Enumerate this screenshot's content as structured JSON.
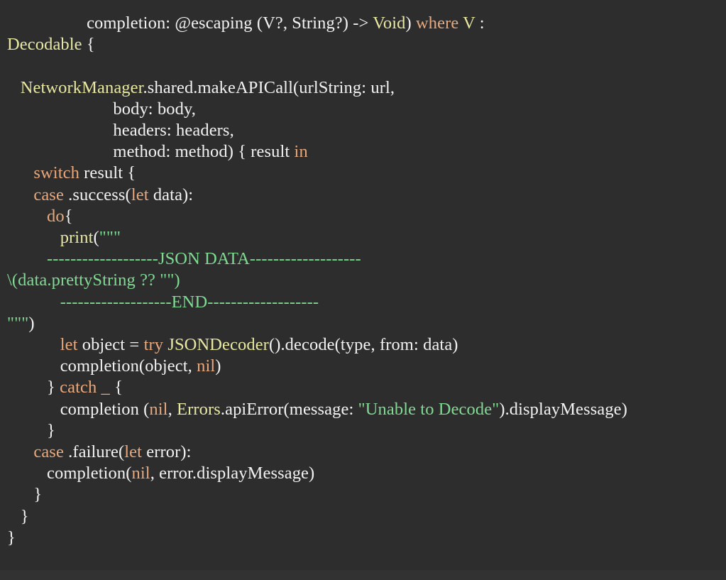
{
  "editor": {
    "language": "swift",
    "background_color": "#2d2d2d",
    "colors": {
      "plain": "#f2f2f2",
      "keyword": "#e8a87c",
      "type": "#e8e8a2",
      "string": "#7fdb92"
    }
  },
  "code": {
    "lines": [
      {
        "id": "line-1",
        "tokens": [
          {
            "text": "                  completion: @escaping (V?, String?) -> ",
            "kind": "plain"
          },
          {
            "text": "Void",
            "kind": "type"
          },
          {
            "text": ") ",
            "kind": "plain"
          },
          {
            "text": "where",
            "kind": "keyword"
          },
          {
            "text": " ",
            "kind": "plain"
          },
          {
            "text": "V",
            "kind": "type"
          },
          {
            "text": " :",
            "kind": "plain"
          }
        ]
      },
      {
        "id": "line-2",
        "tokens": [
          {
            "text": "Decodable",
            "kind": "type"
          },
          {
            "text": " {",
            "kind": "plain"
          }
        ]
      },
      {
        "id": "line-3",
        "tokens": [
          {
            "text": "",
            "kind": "plain"
          }
        ]
      },
      {
        "id": "line-4",
        "tokens": [
          {
            "text": "   ",
            "kind": "plain"
          },
          {
            "text": "NetworkManager",
            "kind": "type"
          },
          {
            "text": ".shared.makeAPICall(urlString: url,",
            "kind": "plain"
          }
        ]
      },
      {
        "id": "line-5",
        "tokens": [
          {
            "text": "                        body: body,",
            "kind": "plain"
          }
        ]
      },
      {
        "id": "line-6",
        "tokens": [
          {
            "text": "                        headers: headers,",
            "kind": "plain"
          }
        ]
      },
      {
        "id": "line-7",
        "tokens": [
          {
            "text": "                        method: method) { result ",
            "kind": "plain"
          },
          {
            "text": "in",
            "kind": "keyword"
          }
        ]
      },
      {
        "id": "line-8",
        "tokens": [
          {
            "text": "      ",
            "kind": "plain"
          },
          {
            "text": "switch",
            "kind": "keyword"
          },
          {
            "text": " result {",
            "kind": "plain"
          }
        ]
      },
      {
        "id": "line-9",
        "tokens": [
          {
            "text": "      ",
            "kind": "plain"
          },
          {
            "text": "case",
            "kind": "keyword"
          },
          {
            "text": " .success(",
            "kind": "plain"
          },
          {
            "text": "let",
            "kind": "keyword"
          },
          {
            "text": " data):",
            "kind": "plain"
          }
        ]
      },
      {
        "id": "line-10",
        "tokens": [
          {
            "text": "         ",
            "kind": "plain"
          },
          {
            "text": "do",
            "kind": "keyword"
          },
          {
            "text": "{",
            "kind": "plain"
          }
        ]
      },
      {
        "id": "line-11",
        "tokens": [
          {
            "text": "            ",
            "kind": "plain"
          },
          {
            "text": "print",
            "kind": "type"
          },
          {
            "text": "(",
            "kind": "plain"
          },
          {
            "text": "\"\"\"",
            "kind": "string"
          }
        ]
      },
      {
        "id": "line-12",
        "tokens": [
          {
            "text": "         -------------------JSON DATA-------------------",
            "kind": "string"
          }
        ]
      },
      {
        "id": "line-13",
        "tokens": [
          {
            "text": "\\(data.prettyString ?? \"\")",
            "kind": "string"
          }
        ]
      },
      {
        "id": "line-14",
        "tokens": [
          {
            "text": "            -------------------END-------------------",
            "kind": "string"
          }
        ]
      },
      {
        "id": "line-15",
        "tokens": [
          {
            "text": "\"\"\"",
            "kind": "string"
          },
          {
            "text": ")",
            "kind": "plain"
          }
        ]
      },
      {
        "id": "line-16",
        "tokens": [
          {
            "text": "            ",
            "kind": "plain"
          },
          {
            "text": "let",
            "kind": "keyword"
          },
          {
            "text": " object = ",
            "kind": "plain"
          },
          {
            "text": "try",
            "kind": "keyword"
          },
          {
            "text": " ",
            "kind": "plain"
          },
          {
            "text": "JSONDecoder",
            "kind": "type"
          },
          {
            "text": "().decode(type, from: data)",
            "kind": "plain"
          }
        ]
      },
      {
        "id": "line-17",
        "tokens": [
          {
            "text": "            completion(object, ",
            "kind": "plain"
          },
          {
            "text": "nil",
            "kind": "keyword"
          },
          {
            "text": ")",
            "kind": "plain"
          }
        ]
      },
      {
        "id": "line-18",
        "tokens": [
          {
            "text": "         } ",
            "kind": "plain"
          },
          {
            "text": "catch",
            "kind": "keyword"
          },
          {
            "text": " ",
            "kind": "plain"
          },
          {
            "text": "_",
            "kind": "keyword"
          },
          {
            "text": " {",
            "kind": "plain"
          }
        ]
      },
      {
        "id": "line-19",
        "tokens": [
          {
            "text": "            completion (",
            "kind": "plain"
          },
          {
            "text": "nil",
            "kind": "keyword"
          },
          {
            "text": ", ",
            "kind": "plain"
          },
          {
            "text": "Errors",
            "kind": "type"
          },
          {
            "text": ".apiError(message: ",
            "kind": "plain"
          },
          {
            "text": "\"Unable to Decode\"",
            "kind": "string"
          },
          {
            "text": ").displayMessage)",
            "kind": "plain"
          }
        ]
      },
      {
        "id": "line-20",
        "tokens": [
          {
            "text": "         }",
            "kind": "plain"
          }
        ]
      },
      {
        "id": "line-21",
        "tokens": [
          {
            "text": "      ",
            "kind": "plain"
          },
          {
            "text": "case",
            "kind": "keyword"
          },
          {
            "text": " .failure(",
            "kind": "plain"
          },
          {
            "text": "let",
            "kind": "keyword"
          },
          {
            "text": " error):",
            "kind": "plain"
          }
        ]
      },
      {
        "id": "line-22",
        "tokens": [
          {
            "text": "         completion(",
            "kind": "plain"
          },
          {
            "text": "nil",
            "kind": "keyword"
          },
          {
            "text": ", error.displayMessage)",
            "kind": "plain"
          }
        ]
      },
      {
        "id": "line-23",
        "tokens": [
          {
            "text": "      }",
            "kind": "plain"
          }
        ]
      },
      {
        "id": "line-24",
        "tokens": [
          {
            "text": "   }",
            "kind": "plain"
          }
        ]
      },
      {
        "id": "line-25",
        "tokens": [
          {
            "text": "}",
            "kind": "plain"
          }
        ]
      }
    ]
  }
}
